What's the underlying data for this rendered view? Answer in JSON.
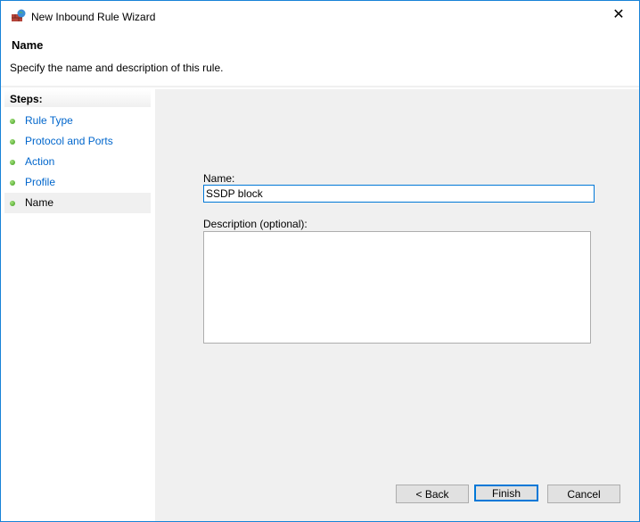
{
  "window": {
    "title": "New Inbound Rule Wizard",
    "icon": "firewall-globe-icon",
    "close_icon": "close-icon"
  },
  "header": {
    "title": "Name",
    "subtitle": "Specify the name and description of this rule."
  },
  "steps": {
    "heading": "Steps:",
    "items": [
      {
        "label": "Rule Type",
        "active": false
      },
      {
        "label": "Protocol and Ports",
        "active": false
      },
      {
        "label": "Action",
        "active": false
      },
      {
        "label": "Profile",
        "active": false
      },
      {
        "label": "Name",
        "active": true
      }
    ]
  },
  "form": {
    "name_label": "Name:",
    "name_value": "SSDP block",
    "description_label": "Description (optional):",
    "description_value": ""
  },
  "buttons": {
    "back": "< Back",
    "finish": "Finish",
    "cancel": "Cancel"
  },
  "colors": {
    "accent": "#0078d7",
    "link": "#0066cc",
    "step_dot": "#4caf25"
  }
}
